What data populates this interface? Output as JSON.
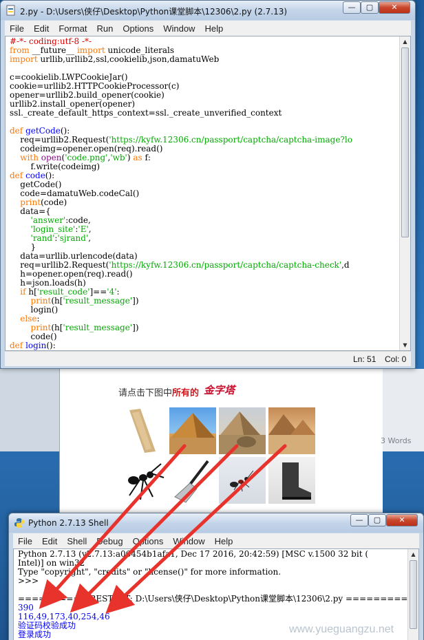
{
  "editor": {
    "title": "2.py - D:\\Users\\侠仔\\Desktop\\Python课堂脚本\\12306\\2.py (2.7.13)",
    "menu": [
      "File",
      "Edit",
      "Format",
      "Run",
      "Options",
      "Window",
      "Help"
    ],
    "status": {
      "line": "Ln: 51",
      "col": "Col: 0"
    }
  },
  "shell": {
    "title": "Python 2.7.13 Shell",
    "menu": [
      "File",
      "Edit",
      "Shell",
      "Debug",
      "Options",
      "Window",
      "Help"
    ],
    "banner": [
      "Python 2.7.13 (v2.7.13:a06454b1afa1, Dec 17 2016, 20:42:59) [MSC v.1500 32 bit (",
      "Intel)] on win32",
      "Type \"copyright\", \"credits\" or \"license()\" for more information.",
      ">>> ",
      "========== RESTART: D:\\Users\\侠仔\\Desktop\\Python课堂脚本\\12306\\2.py =========="
    ],
    "output": [
      "390",
      "116,49,173,40,254,46",
      "验证码校验成功",
      "登录成功"
    ],
    "prompt": ">>> "
  },
  "captcha": {
    "prompt_prefix": "请点击下图中",
    "prompt_emph": "所有的",
    "word": "金字塔"
  },
  "desktop": {
    "words_count": "3 Words"
  },
  "watermark": "www.yueguangzu.net",
  "colors": {
    "keyword": "#ff7700",
    "string": "#00aa00",
    "comment": "#dd0000",
    "definition": "#0000ff",
    "builtin": "#900090",
    "arrow": "#e8322c"
  }
}
